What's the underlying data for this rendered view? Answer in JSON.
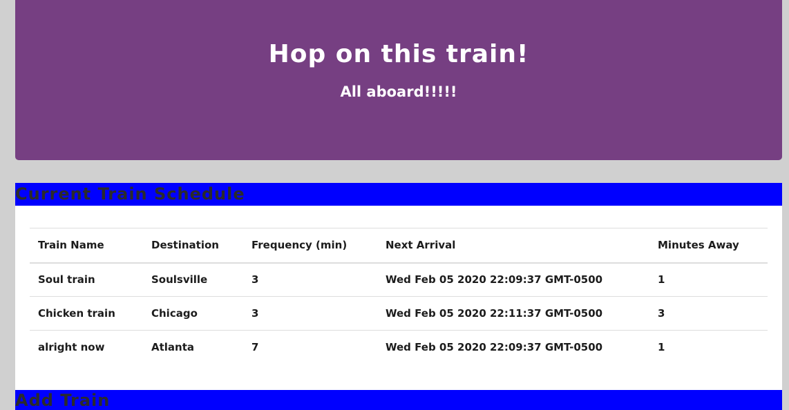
{
  "header": {
    "title": "Hop on this train!",
    "subtitle": "All aboard!!!!!"
  },
  "schedule": {
    "heading": "Current Train Schedule",
    "columns": [
      "Train Name",
      "Destination",
      "Frequency (min)",
      "Next Arrival",
      "Minutes Away"
    ],
    "rows": [
      [
        "Soul train",
        "Soulsville",
        "3",
        "Wed Feb 05 2020 22:09:37 GMT-0500",
        "1"
      ],
      [
        "Chicken train",
        "Chicago",
        "3",
        "Wed Feb 05 2020 22:11:37 GMT-0500",
        "3"
      ],
      [
        "alright now",
        "Atlanta",
        "7",
        "Wed Feb 05 2020 22:09:37 GMT-0500",
        "1"
      ]
    ]
  },
  "add_train": {
    "heading": "Add Train"
  },
  "colors": {
    "page_background": "#d0d0d0",
    "jumbotron": "#763f82",
    "panel_heading": "#0000ff"
  }
}
